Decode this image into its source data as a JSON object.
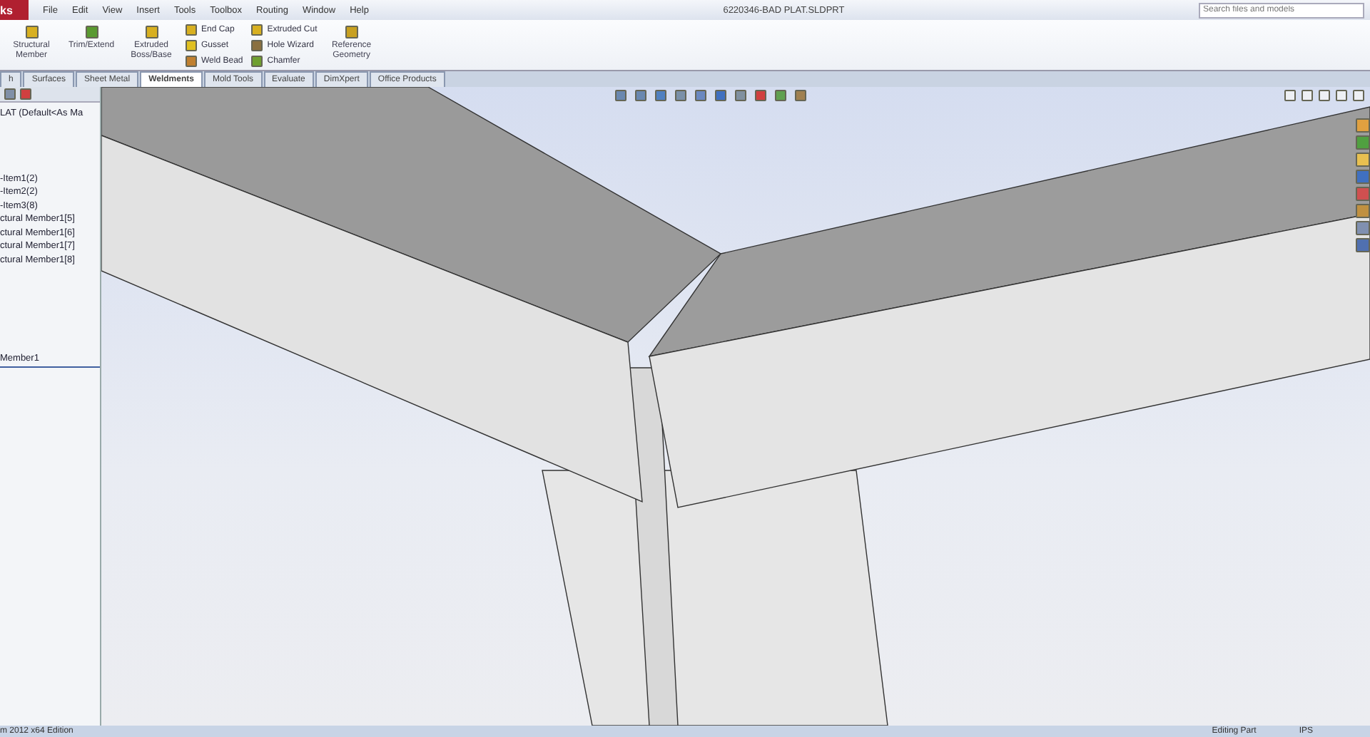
{
  "app": {
    "logo_text": "ks",
    "menu": [
      "File",
      "Edit",
      "View",
      "Insert",
      "Tools",
      "Toolbox",
      "Routing",
      "Window",
      "Help"
    ],
    "title": "6220346-BAD PLAT.SLDPRT",
    "search": {
      "placeholder": "Search files and models"
    }
  },
  "ribbon": {
    "large": [
      {
        "label": "Structural Member",
        "color": "#d8b020"
      },
      {
        "label": "Trim/Extend",
        "color": "#5a9a30"
      },
      {
        "label": "Extruded Boss/Base",
        "color": "#d8b020"
      }
    ],
    "small_groups": [
      [
        {
          "label": "End Cap",
          "color": "#d8b020"
        },
        {
          "label": "Gusset",
          "color": "#e0c020"
        },
        {
          "label": "Weld Bead",
          "color": "#c08030"
        }
      ],
      [
        {
          "label": "Extruded Cut",
          "color": "#d8b020"
        },
        {
          "label": "Hole Wizard",
          "color": "#8a7040"
        },
        {
          "label": "Chamfer",
          "color": "#70a030"
        }
      ]
    ],
    "reference": {
      "label": "Reference Geometry",
      "color": "#c8a020"
    }
  },
  "tabs": [
    {
      "label": "h",
      "selected": false
    },
    {
      "label": "Surfaces",
      "selected": false
    },
    {
      "label": "Sheet Metal",
      "selected": false
    },
    {
      "label": "Weldments",
      "selected": true
    },
    {
      "label": "Mold Tools",
      "selected": false
    },
    {
      "label": "Evaluate",
      "selected": false
    },
    {
      "label": "DimXpert",
      "selected": false
    },
    {
      "label": "Office Products",
      "selected": false
    }
  ],
  "tree": [
    {
      "label": "LAT (Default<As Ma",
      "selected": false
    },
    {
      "label": "-Item1(2)",
      "selected": false
    },
    {
      "label": "-Item2(2)",
      "selected": false
    },
    {
      "label": "-Item3(8)",
      "selected": false
    },
    {
      "label": "ctural Member1[5]",
      "selected": false
    },
    {
      "label": "ctural Member1[6]",
      "selected": false
    },
    {
      "label": "ctural Member1[7]",
      "selected": false
    },
    {
      "label": "ctural Member1[8]",
      "selected": false
    },
    {
      "label": "Member1",
      "selected": true
    }
  ],
  "status_bar": {
    "edition": "m 2012 x64 Edition",
    "mode": "Editing Part",
    "units": "IPS"
  }
}
